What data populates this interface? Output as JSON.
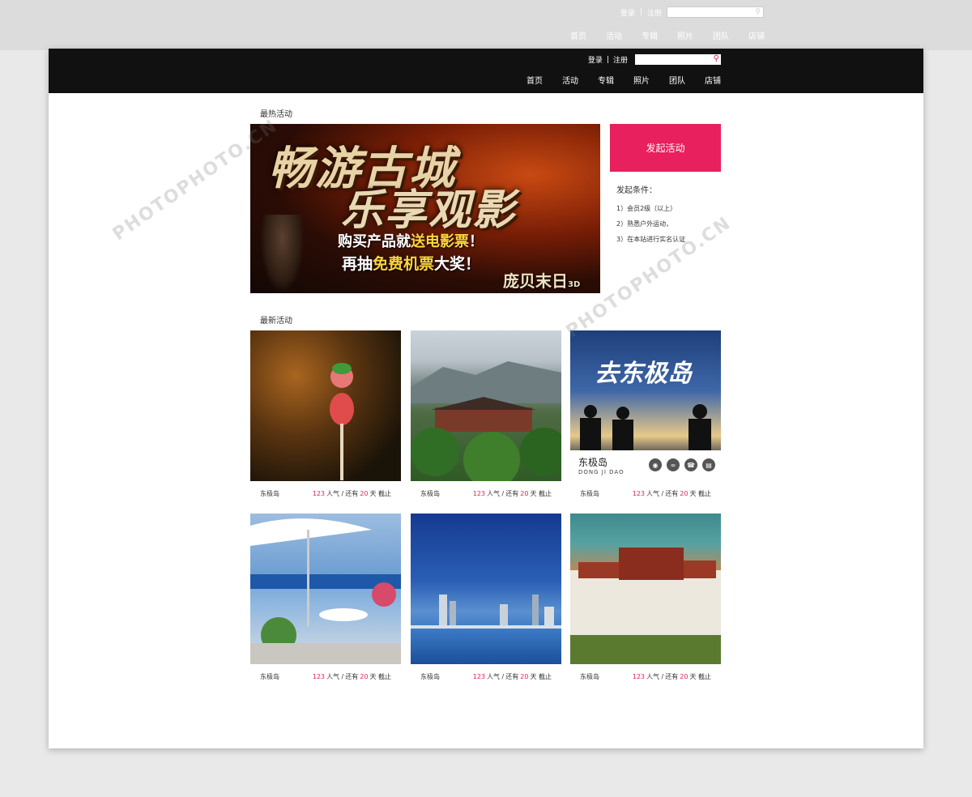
{
  "top": {
    "login": "登录",
    "sep": "|",
    "register": "注册",
    "search_placeholder": ""
  },
  "nav": [
    "首页",
    "活动",
    "专辑",
    "照片",
    "团队",
    "店铺"
  ],
  "hot": {
    "label": "最热活动",
    "banner": {
      "line1": "畅游古城",
      "line2": "乐享观影",
      "line3a": "购买产品就",
      "line3b": "送电影票",
      "line3c": "！",
      "line4a": "再抽",
      "line4b": "免费机票",
      "line4c": "大奖！",
      "movie": "庞贝末日",
      "movie_3d": "3D"
    }
  },
  "side": {
    "start_label": "发起活动",
    "cond_title": "发起条件：",
    "conditions": [
      "1）会员2级（以上）",
      "2）熟悉户外运动，",
      "3）在本站进行实名认证"
    ]
  },
  "latest": {
    "label": "最新活动",
    "featured": {
      "name": "东极岛",
      "pinyin": "DONG JI DAO",
      "title_art": "去东极岛"
    },
    "cards": [
      {
        "name": "东极岛",
        "count": "123",
        "pop": "人气 /",
        "remain": "还有",
        "days": "20",
        "unit": "天 截止"
      },
      {
        "name": "东极岛",
        "count": "123",
        "pop": "人气 /",
        "remain": "还有",
        "days": "20",
        "unit": "天 截止"
      },
      {
        "name": "东极岛",
        "count": "123",
        "pop": "人气 /",
        "remain": "还有",
        "days": "20",
        "unit": "天 截止"
      },
      {
        "name": "东极岛",
        "count": "123",
        "pop": "人气 /",
        "remain": "还有",
        "days": "20",
        "unit": "天 截止"
      },
      {
        "name": "东极岛",
        "count": "123",
        "pop": "人气 /",
        "remain": "还有",
        "days": "20",
        "unit": "天 截止"
      },
      {
        "name": "东极岛",
        "count": "123",
        "pop": "人气 /",
        "remain": "还有",
        "days": "20",
        "unit": "天 截止"
      }
    ]
  },
  "watermark": "PHOTOPHOTO.CN",
  "colors": {
    "accent": "#e8205e",
    "header": "#111111"
  }
}
